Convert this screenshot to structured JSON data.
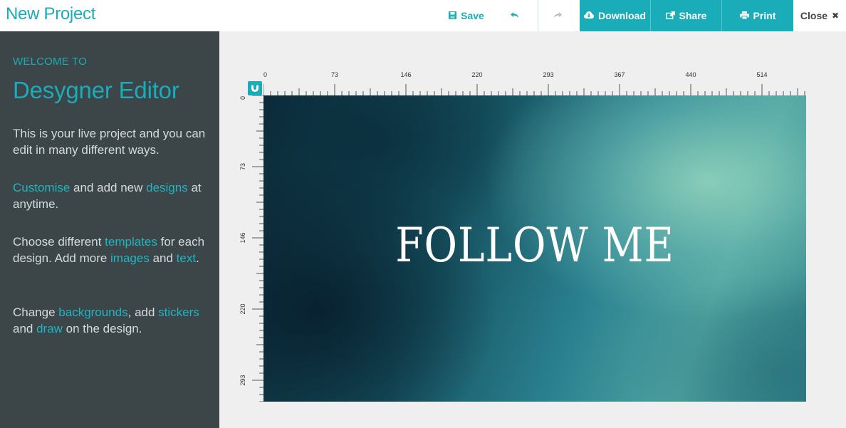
{
  "header": {
    "title": "New Project",
    "save_label": "Save",
    "download_label": "Download",
    "share_label": "Share",
    "print_label": "Print",
    "close_label": "Close"
  },
  "sidebar": {
    "kicker": "WELCOME TO",
    "title": "Desygner Editor",
    "p1": "This is your live project and you can edit in many different ways.",
    "p2": {
      "link1": "Customise",
      "t1": " and add new ",
      "link2": "designs",
      "t2": " at anytime."
    },
    "p3": {
      "t1": "Choose different ",
      "link1": "templates",
      "t2": " for each design. Add more ",
      "link2": "images",
      "t3": " and ",
      "link3": "text",
      "t4": "."
    },
    "p4": {
      "t1": "Change ",
      "link1": "backgrounds",
      "t2": ", add ",
      "link2": "stickers",
      "t3": " and ",
      "link3": "draw",
      "t4": " on the design."
    }
  },
  "ruler": {
    "top_labels": [
      "0",
      "73",
      "146",
      "220",
      "293",
      "367",
      "440",
      "514"
    ],
    "left_labels": [
      "0",
      "73",
      "146",
      "220",
      "293"
    ]
  },
  "design": {
    "text": "FOLLOW ME"
  },
  "colors": {
    "accent": "#1aacb8",
    "sidebar_bg": "#3c4547"
  },
  "icons": {
    "save": "floppy-disk-icon",
    "undo": "undo-arrow-icon",
    "redo": "redo-arrow-icon",
    "download": "cloud-download-icon",
    "share": "share-icon",
    "print": "printer-icon",
    "close": "close-icon",
    "magnet": "magnet-icon"
  }
}
